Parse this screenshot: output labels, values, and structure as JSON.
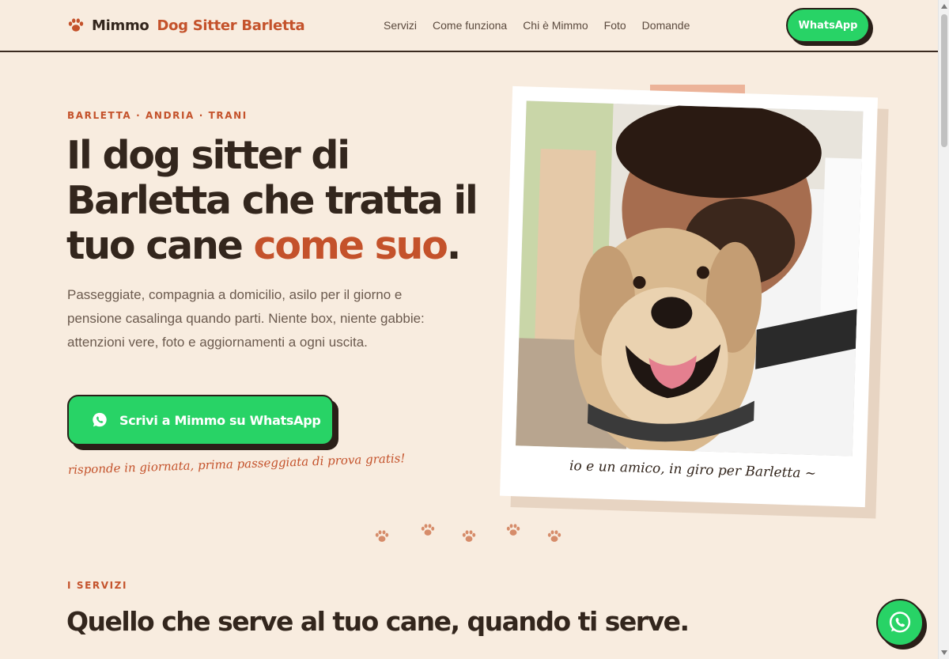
{
  "header": {
    "brand_name": "Mimmo",
    "brand_sub": "Dog Sitter Barletta",
    "nav": [
      "Servizi",
      "Come funziona",
      "Chi è Mimmo",
      "Foto",
      "Domande"
    ],
    "whatsapp_label": "WhatsApp"
  },
  "hero": {
    "kicker": "BARLETTA · ANDRIA · TRANI",
    "title_part1": "Il dog sitter di Barletta che tratta il tuo cane ",
    "title_accent": "come suo",
    "title_end": ".",
    "description": "Passeggiate, compagnia a domicilio, asilo per il giorno e pensione casalinga quando parti. Niente box, niente gabbie: attenzioni vere, foto e aggiornamenti a ogni uscita.",
    "cta_label": "Scrivi a Mimmo su WhatsApp",
    "note": "risponde in giornata, prima passeggiata di prova gratis!",
    "photo_caption": "io e un amico, in giro per Barletta ~"
  },
  "services": {
    "kicker": "I SERVIZI",
    "title": "Quello che serve al tuo cane, quando ti serve."
  },
  "icons": {
    "brand": "paw-icon",
    "whatsapp": "whatsapp-icon"
  },
  "colors": {
    "background": "#f8ecdf",
    "accent": "#c4522b",
    "whatsapp": "#28d366",
    "ink": "#33261d"
  }
}
